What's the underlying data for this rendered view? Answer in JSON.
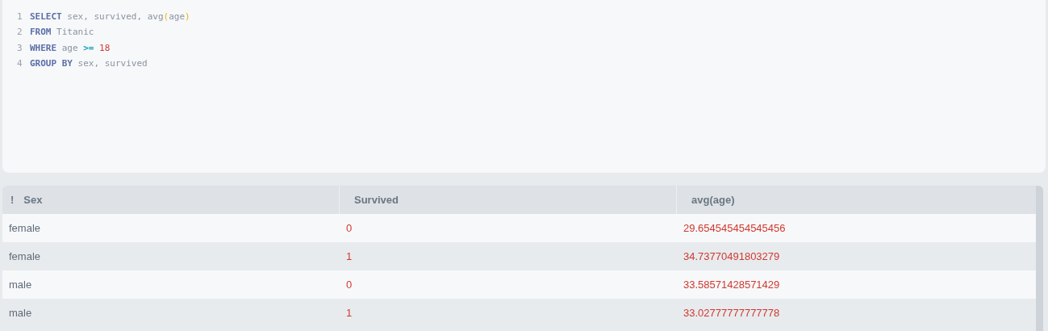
{
  "editor": {
    "lines": [
      {
        "number": "1",
        "tokens": [
          {
            "kind": "keyword",
            "text": "SELECT"
          },
          {
            "kind": "ident",
            "text": " sex, survived, avg"
          },
          {
            "kind": "paren",
            "text": "("
          },
          {
            "kind": "ident",
            "text": "age"
          },
          {
            "kind": "paren",
            "text": ")"
          }
        ]
      },
      {
        "number": "2",
        "tokens": [
          {
            "kind": "keyword",
            "text": "FROM"
          },
          {
            "kind": "ident",
            "text": " Titanic"
          }
        ]
      },
      {
        "number": "3",
        "tokens": [
          {
            "kind": "keyword",
            "text": "WHERE"
          },
          {
            "kind": "ident",
            "text": " age "
          },
          {
            "kind": "operator",
            "text": ">="
          },
          {
            "kind": "number",
            "text": " 18"
          }
        ]
      },
      {
        "number": "4",
        "tokens": [
          {
            "kind": "keyword",
            "text": "GROUP BY"
          },
          {
            "kind": "ident",
            "text": " sex, survived"
          }
        ]
      }
    ]
  },
  "table": {
    "columns": [
      {
        "label": "Sex",
        "marker": "!"
      },
      {
        "label": "Survived"
      },
      {
        "label": "avg(age)"
      }
    ],
    "rows": [
      [
        {
          "kind": "text",
          "text": "female"
        },
        {
          "kind": "number",
          "text": "0"
        },
        {
          "kind": "number",
          "text": "29.654545454545456"
        }
      ],
      [
        {
          "kind": "text",
          "text": "female"
        },
        {
          "kind": "number",
          "text": "1"
        },
        {
          "kind": "number",
          "text": "34.73770491803279"
        }
      ],
      [
        {
          "kind": "text",
          "text": "male"
        },
        {
          "kind": "number",
          "text": "0"
        },
        {
          "kind": "number",
          "text": "33.58571428571429"
        }
      ],
      [
        {
          "kind": "text",
          "text": "male"
        },
        {
          "kind": "number",
          "text": "1"
        },
        {
          "kind": "number",
          "text": "33.02777777777778"
        }
      ]
    ]
  }
}
